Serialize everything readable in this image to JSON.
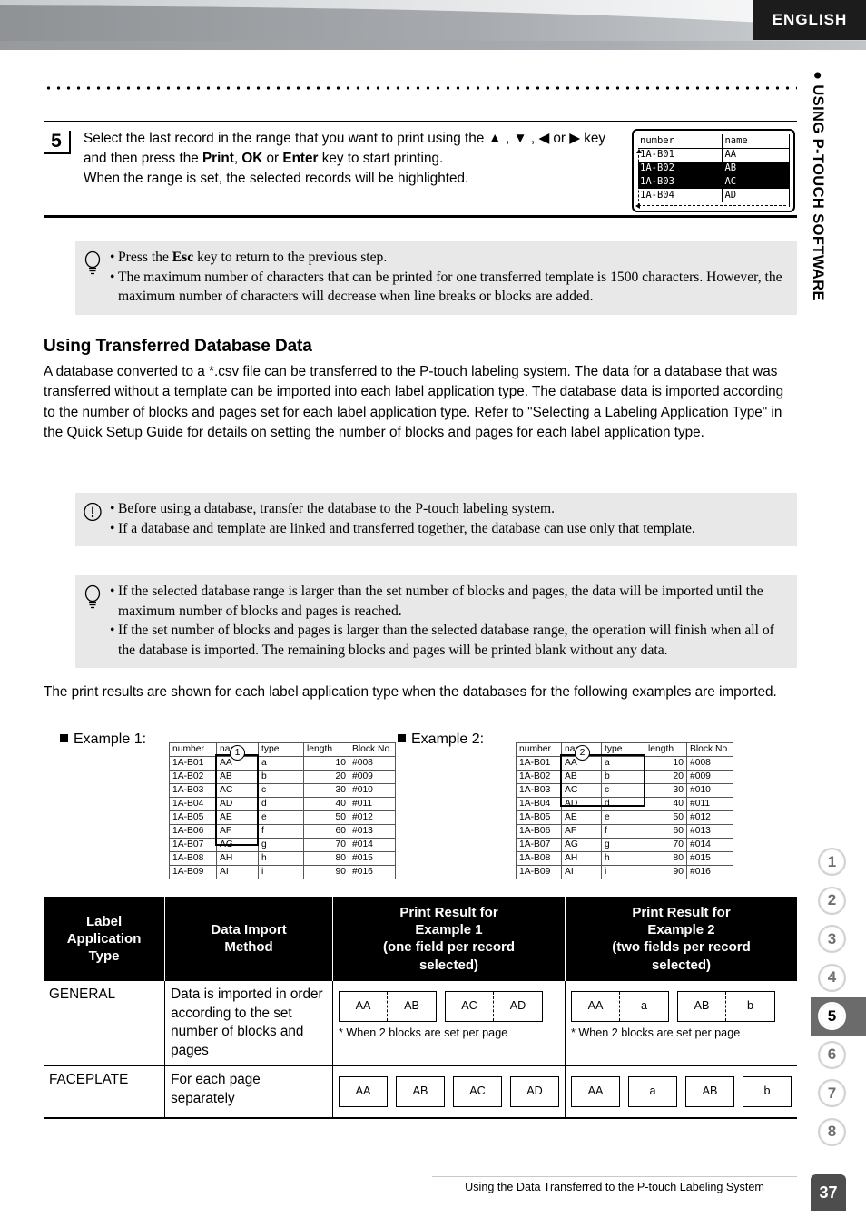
{
  "header": {
    "language_badge": "ENGLISH",
    "side_title": "● USING P-TOUCH SOFTWARE"
  },
  "step": {
    "number": "5",
    "text_part1": "Select the last record in the range that you want to print using the ",
    "keys": "▲ , ▼ , ◀ or ▶",
    "text_part2": " key and then press the ",
    "key_print": "Print",
    "sep1": ", ",
    "key_ok": "OK",
    "sep2": " or ",
    "key_enter": "Enter",
    "text_part3": " key to start printing.",
    "text_part4": "When the range is set, the selected records will be highlighted."
  },
  "lcd": {
    "header": {
      "col1": "number",
      "col2": "name"
    },
    "rows": [
      {
        "col1": "1A-B01",
        "col2": "AA",
        "selected": false
      },
      {
        "col1": "1A-B02",
        "col2": "AB",
        "selected": true
      },
      {
        "col1": "1A-B03",
        "col2": "AC",
        "selected": true
      },
      {
        "col1": "1A-B04",
        "col2": "AD",
        "selected": false
      }
    ]
  },
  "note_tip_1": {
    "icon": "lightbulb-icon",
    "items": [
      {
        "pre": "Press the ",
        "bold": "Esc",
        "post": " key to return to the previous step."
      },
      {
        "pre": "The maximum number of characters that can be printed for one transferred template is 1500 characters. However, the maximum number of characters will decrease when line breaks or blocks are added.",
        "bold": "",
        "post": ""
      }
    ]
  },
  "section": {
    "heading": "Using Transferred Database Data",
    "paragraph": "A database converted to a *.csv file can be transferred to the P-touch labeling system. The data for a database that was transferred without a template can be imported into each label application type. The database data is imported according to the number of blocks and pages set for each label application type. Refer to \"Selecting a Labeling Application Type\" in the Quick Setup Guide for details on setting the number of blocks and pages for each label application type."
  },
  "note_warn": {
    "icon": "exclamation-icon",
    "items": [
      {
        "pre": "Before using a database, transfer the database to the P-touch labeling system.",
        "bold": "",
        "post": ""
      },
      {
        "pre": "If a database and template are linked and transferred together, the database can use only that template.",
        "bold": "",
        "post": ""
      }
    ]
  },
  "note_tip_2": {
    "icon": "lightbulb-icon",
    "items": [
      {
        "pre": "If the selected database range is larger than the set number of blocks and pages, the data will be imported until the maximum number of blocks and pages is reached.",
        "bold": "",
        "post": ""
      },
      {
        "pre": "If the set number of blocks and pages is larger than the selected database range, the operation will finish when all of the database is imported. The remaining blocks and pages will be printed blank without any data.",
        "bold": "",
        "post": ""
      }
    ]
  },
  "print_paragraph": "The print results are shown for each label application type when the databases for the following examples are imported.",
  "example1": {
    "label": "Example 1:",
    "marker": "1",
    "columns": [
      "number",
      "name",
      "type",
      "length",
      "Block No."
    ],
    "rows": [
      [
        "1A-B01",
        "AA",
        "a",
        "10",
        "#008"
      ],
      [
        "1A-B02",
        "AB",
        "b",
        "20",
        "#009"
      ],
      [
        "1A-B03",
        "AC",
        "c",
        "30",
        "#010"
      ],
      [
        "1A-B04",
        "AD",
        "d",
        "40",
        "#011"
      ],
      [
        "1A-B05",
        "AE",
        "e",
        "50",
        "#012"
      ],
      [
        "1A-B06",
        "AF",
        "f",
        "60",
        "#013"
      ],
      [
        "1A-B07",
        "AG",
        "g",
        "70",
        "#014"
      ],
      [
        "1A-B08",
        "AH",
        "h",
        "80",
        "#015"
      ],
      [
        "1A-B09",
        "AI",
        "i",
        "90",
        "#016"
      ]
    ]
  },
  "example2": {
    "label": "Example 2:",
    "marker": "2",
    "columns": [
      "number",
      "name",
      "type",
      "length",
      "Block No."
    ],
    "rows": [
      [
        "1A-B01",
        "AA",
        "a",
        "10",
        "#008"
      ],
      [
        "1A-B02",
        "AB",
        "b",
        "20",
        "#009"
      ],
      [
        "1A-B03",
        "AC",
        "c",
        "30",
        "#010"
      ],
      [
        "1A-B04",
        "AD",
        "d",
        "40",
        "#011"
      ],
      [
        "1A-B05",
        "AE",
        "e",
        "50",
        "#012"
      ],
      [
        "1A-B06",
        "AF",
        "f",
        "60",
        "#013"
      ],
      [
        "1A-B07",
        "AG",
        "g",
        "70",
        "#014"
      ],
      [
        "1A-B08",
        "AH",
        "h",
        "80",
        "#015"
      ],
      [
        "1A-B09",
        "AI",
        "i",
        "90",
        "#016"
      ]
    ]
  },
  "result_table": {
    "headers": [
      "Label\nApplication\nType",
      "Data Import\nMethod",
      "Print Result for\nExample 1\n(one field per record\nselected)",
      "Print Result for\nExample 2\n(two fields per record\nselected)"
    ],
    "header_lines": [
      [
        "Label",
        "Application",
        "Type"
      ],
      [
        "Data Import",
        "Method"
      ],
      [
        "Print Result for",
        "Example 1",
        "(one field per record",
        "selected)"
      ],
      [
        "Print Result for",
        "Example 2",
        "(two fields per record",
        "selected)"
      ]
    ],
    "rows": [
      {
        "type": "GENERAL",
        "method": "Data is imported in order according to the set number of blocks and pages",
        "ex1_blocks": [
          [
            "AA",
            "AB"
          ],
          [
            "AC",
            "AD"
          ]
        ],
        "ex1_note": "* When 2 blocks are set per page",
        "ex2_blocks": [
          [
            "AA",
            "a"
          ],
          [
            "AB",
            "b"
          ]
        ],
        "ex2_note": "* When 2 blocks are set per page"
      },
      {
        "type": "FACEPLATE",
        "method": "For each page separately",
        "ex1_blocks": [
          [
            "AA"
          ],
          [
            "AB"
          ],
          [
            "AC"
          ],
          [
            "AD"
          ]
        ],
        "ex1_note": "",
        "ex2_blocks": [
          [
            "AA"
          ],
          [
            "a"
          ],
          [
            "AB"
          ],
          [
            "b"
          ]
        ],
        "ex2_note": ""
      }
    ]
  },
  "chapter_tabs": [
    "1",
    "2",
    "3",
    "4",
    "5",
    "6",
    "7",
    "8"
  ],
  "active_chapter": "5",
  "footer": {
    "text": "Using the Data Transferred to the P-touch Labeling System",
    "page_number": "37"
  },
  "colors": {
    "badge_bg": "#1c1c1c",
    "note_bg": "#e8e8e8",
    "active_tab": "#6b6b6b",
    "page_tab": "#4d4d4d"
  }
}
